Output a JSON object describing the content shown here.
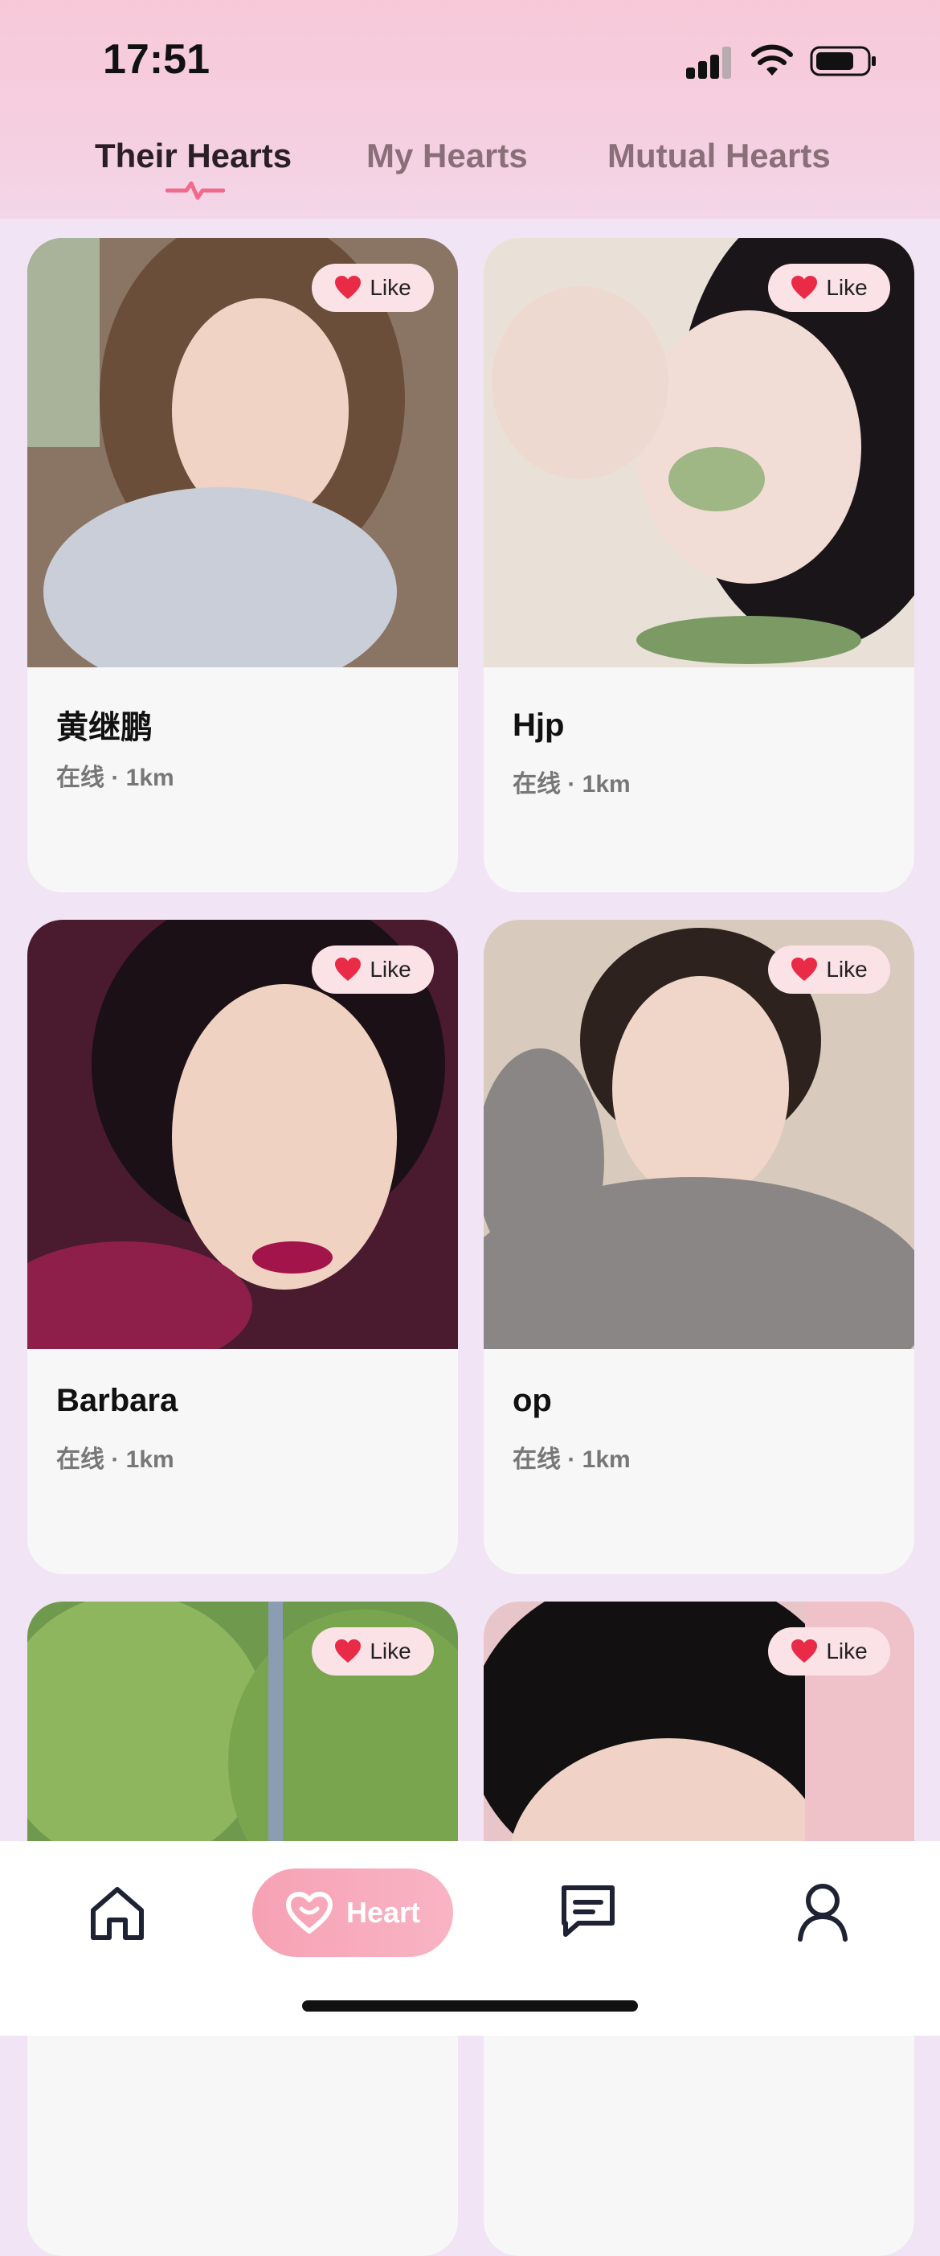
{
  "status_bar": {
    "time": "17:51"
  },
  "tabs": [
    {
      "label": "Their Hearts",
      "active": true
    },
    {
      "label": "My Hearts",
      "active": false
    },
    {
      "label": "Mutual Hearts",
      "active": false
    }
  ],
  "like_label": "Like",
  "cards": [
    {
      "name": "黄继鹏",
      "status": "在线 · 1km"
    },
    {
      "name": "Hjp",
      "status": "在线 · 1km"
    },
    {
      "name": "Barbara",
      "status": "在线 · 1km"
    },
    {
      "name": "op",
      "status": "在线 · 1km"
    },
    {
      "name": "",
      "status": ""
    },
    {
      "name": "",
      "status": ""
    }
  ],
  "bottom_nav": {
    "items": [
      {
        "icon": "home-icon"
      },
      {
        "icon": "heart-icon",
        "label": "Heart",
        "active": true
      },
      {
        "icon": "chat-icon"
      },
      {
        "icon": "profile-icon"
      }
    ]
  },
  "colors": {
    "accent": "#f06a8b",
    "like_heart": "#ea2b48",
    "background": "#f1e4f5"
  }
}
